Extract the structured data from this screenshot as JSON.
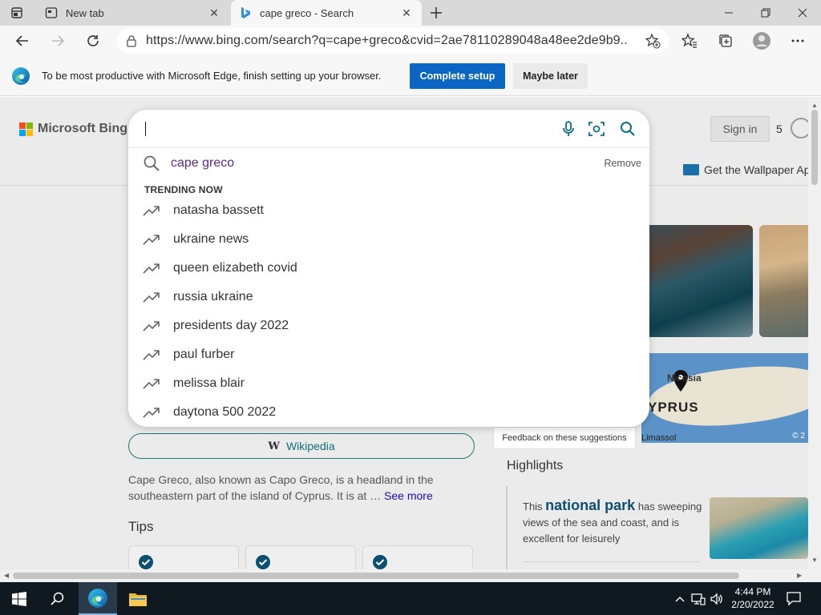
{
  "browser": {
    "tabs": [
      {
        "title": "New tab",
        "active": false
      },
      {
        "title": "cape greco - Search",
        "active": true
      }
    ],
    "url": "https://www.bing.com/search?q=cape+greco&cvid=2ae78110289048a48ee2de9b9..."
  },
  "infobar": {
    "message": "To be most productive with Microsoft Edge, finish setting up your browser.",
    "primary_label": "Complete setup",
    "secondary_label": "Maybe later"
  },
  "bing": {
    "logo_text": "Microsoft Bing",
    "signin_label": "Sign in",
    "rewards_count": "5",
    "wallpaper_link": "Get the Wallpaper Ap",
    "wiki_button": "Wikipedia",
    "wiki_letter": "W",
    "description": "Cape Greco, also known as Capo Greco, is a headland in the southeastern part of the island of Cyprus. It is at …",
    "see_more": "See more",
    "tips_heading": "Tips",
    "feedback": "Feedback on these suggestions",
    "highlights_heading": "Highlights",
    "highlight_prefix": "This ",
    "highlight_keyword": "national park",
    "highlight_suffix": " has sweeping views of the sea and coast, and is excellent for leisurely",
    "map_labels": {
      "city": "Nicosia",
      "country": "YPRUS",
      "town": "Limassol",
      "copyright": "© 2"
    }
  },
  "search": {
    "query": "",
    "history": [
      {
        "text": "cape greco",
        "remove_label": "Remove"
      }
    ],
    "trending_heading": "TRENDING NOW",
    "trending": [
      "natasha bassett",
      "ukraine news",
      "queen elizabeth covid",
      "russia ukraine",
      "presidents day 2022",
      "paul furber",
      "melissa blair",
      "daytona 500 2022"
    ]
  },
  "taskbar": {
    "time": "4:44 PM",
    "date": "2/20/2022"
  },
  "colors": {
    "accent": "#0a66c2",
    "bing_teal": "#0f6e80",
    "history_purple": "#5a2d8a",
    "taskbar": "#101820"
  }
}
